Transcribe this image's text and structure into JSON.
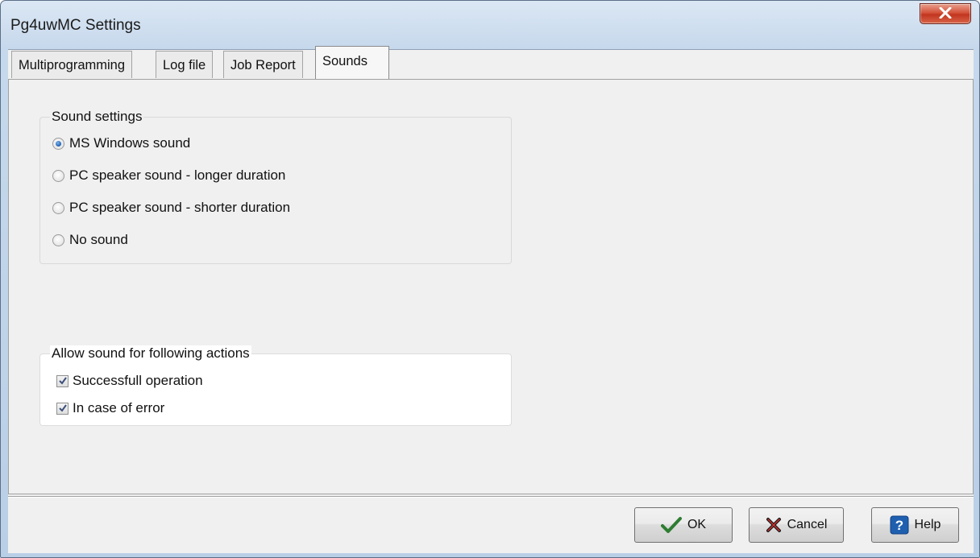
{
  "window": {
    "title": "Pg4uwMC Settings",
    "close_icon": "close-icon"
  },
  "tabs": [
    {
      "label": "Multiprogramming",
      "active": false
    },
    {
      "label": "Log file",
      "active": false
    },
    {
      "label": "Job Report",
      "active": false
    },
    {
      "label": "Sounds",
      "active": true
    }
  ],
  "sound_settings": {
    "title": "Sound settings",
    "selected": "MS Windows sound",
    "options": [
      {
        "label": "MS Windows sound",
        "checked": true
      },
      {
        "label": "PC speaker sound - longer duration",
        "checked": false
      },
      {
        "label": "PC speaker sound - shorter duration",
        "checked": false
      },
      {
        "label": "No sound",
        "checked": false
      }
    ]
  },
  "allow_sound": {
    "title": "Allow sound for following actions",
    "options": [
      {
        "label": "Successfull operation",
        "checked": true
      },
      {
        "label": "In case of error",
        "checked": true
      }
    ]
  },
  "buttons": {
    "ok": {
      "label": "OK",
      "icon": "checkmark-icon"
    },
    "cancel": {
      "label": "Cancel",
      "icon": "x-icon"
    },
    "help": {
      "label": "Help",
      "icon": "help-icon"
    }
  },
  "colors": {
    "ok_icon": "#2e7d32",
    "cancel_icon": "#1a1a1a",
    "help_icon": "#1f5fb0",
    "radio_selected": "#1f5fb0",
    "close_button": "#c2351f"
  }
}
